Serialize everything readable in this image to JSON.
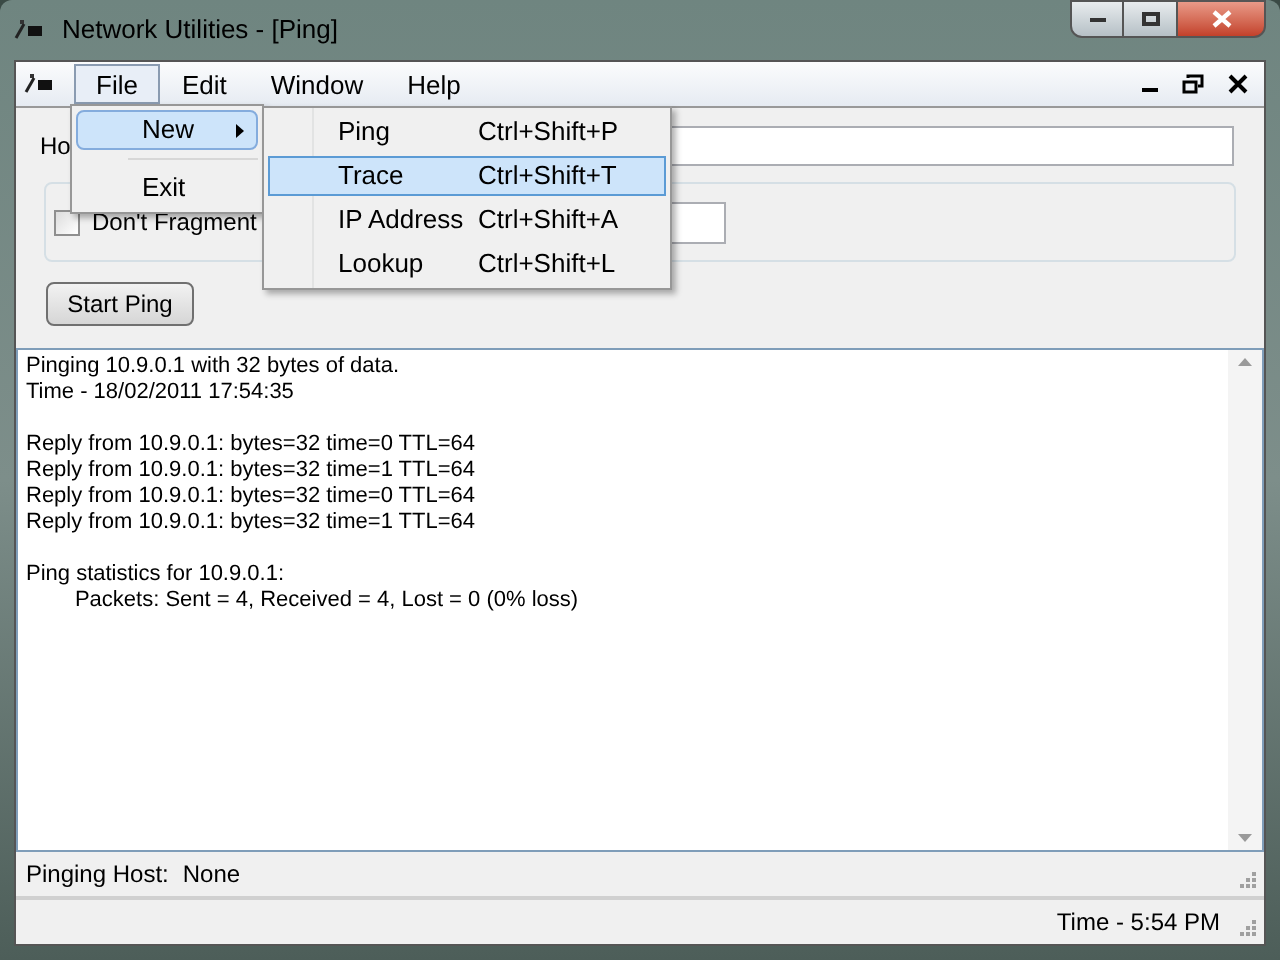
{
  "window": {
    "title": "Network Utilities - [Ping]"
  },
  "menu_bar": [
    {
      "label": "File",
      "selected": true
    },
    {
      "label": "Edit",
      "selected": false
    },
    {
      "label": "Window",
      "selected": false
    },
    {
      "label": "Help",
      "selected": false
    }
  ],
  "file_menu": [
    {
      "kind": "item",
      "label": "New",
      "submenu": true,
      "selected": true
    },
    {
      "kind": "separator"
    },
    {
      "kind": "item",
      "label": "Exit",
      "submenu": false,
      "selected": false
    }
  ],
  "new_submenu": [
    {
      "label": "Ping",
      "shortcut": "Ctrl+Shift+P",
      "selected": false
    },
    {
      "label": "Trace",
      "shortcut": "Ctrl+Shift+T",
      "selected": true
    },
    {
      "label": "IP Address",
      "shortcut": "Ctrl+Shift+A",
      "selected": false
    },
    {
      "label": "Lookup",
      "shortcut": "Ctrl+Shift+L",
      "selected": false
    }
  ],
  "host_label": "Ho",
  "dont_fragment": {
    "label": "Don't Fragment",
    "checked": false
  },
  "start_button": "Start Ping",
  "output_blocks": [
    [
      "Pinging 10.9.0.1 with 32 bytes of data.",
      "Time - 18/02/2011 17:54:35"
    ],
    [
      "Reply from 10.9.0.1: bytes=32 time=0 TTL=64",
      "Reply from 10.9.0.1: bytes=32 time=1 TTL=64",
      "Reply from 10.9.0.1: bytes=32 time=0 TTL=64",
      "Reply from 10.9.0.1: bytes=32 time=1 TTL=64"
    ],
    [
      "Ping statistics for 10.9.0.1:",
      "\tPackets: Sent = 4, Received = 4, Lost = 0 (0% loss)"
    ]
  ],
  "child_status": {
    "label": "Pinging Host:",
    "value": "None"
  },
  "status_bar": "Time - 5:54 PM"
}
